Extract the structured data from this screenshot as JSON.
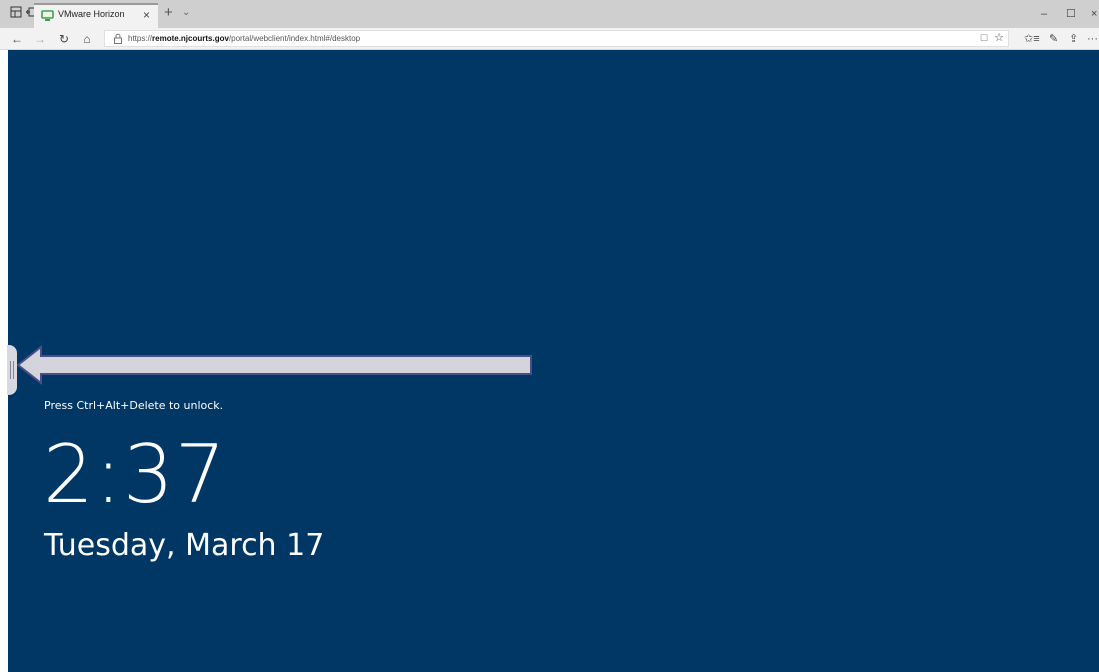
{
  "browser": {
    "tab_title": "VMware Horizon",
    "tab_close": "×",
    "new_tab": "+",
    "tab_menu": "⌄",
    "window": {
      "minimize": "–",
      "maximize": "☐",
      "close": "×"
    },
    "nav": {
      "back": "←",
      "forward": "→",
      "refresh": "↻",
      "home": "⌂"
    },
    "address": {
      "prefix": "https://",
      "host": "remote.njcourts.gov",
      "path": "/portal/webclient/index.html#/desktop"
    },
    "reading_view": "☐",
    "favorite": "☆",
    "tools": {
      "favorites_list": "✩≡",
      "notes": "✎",
      "share": "⇪",
      "more": "···"
    },
    "colors": {
      "tabstrip": "#cfcfcf",
      "toolbar": "#f2f2f2",
      "favicon": "#3aa545"
    }
  },
  "desktop": {
    "background": "#003765",
    "unlock_message": "Press Ctrl+Alt+Delete to unlock.",
    "time": "2:37",
    "date": "Tuesday, March 17",
    "arrow_color": "#d4d5dc",
    "arrow_border": "#4b4d86"
  }
}
